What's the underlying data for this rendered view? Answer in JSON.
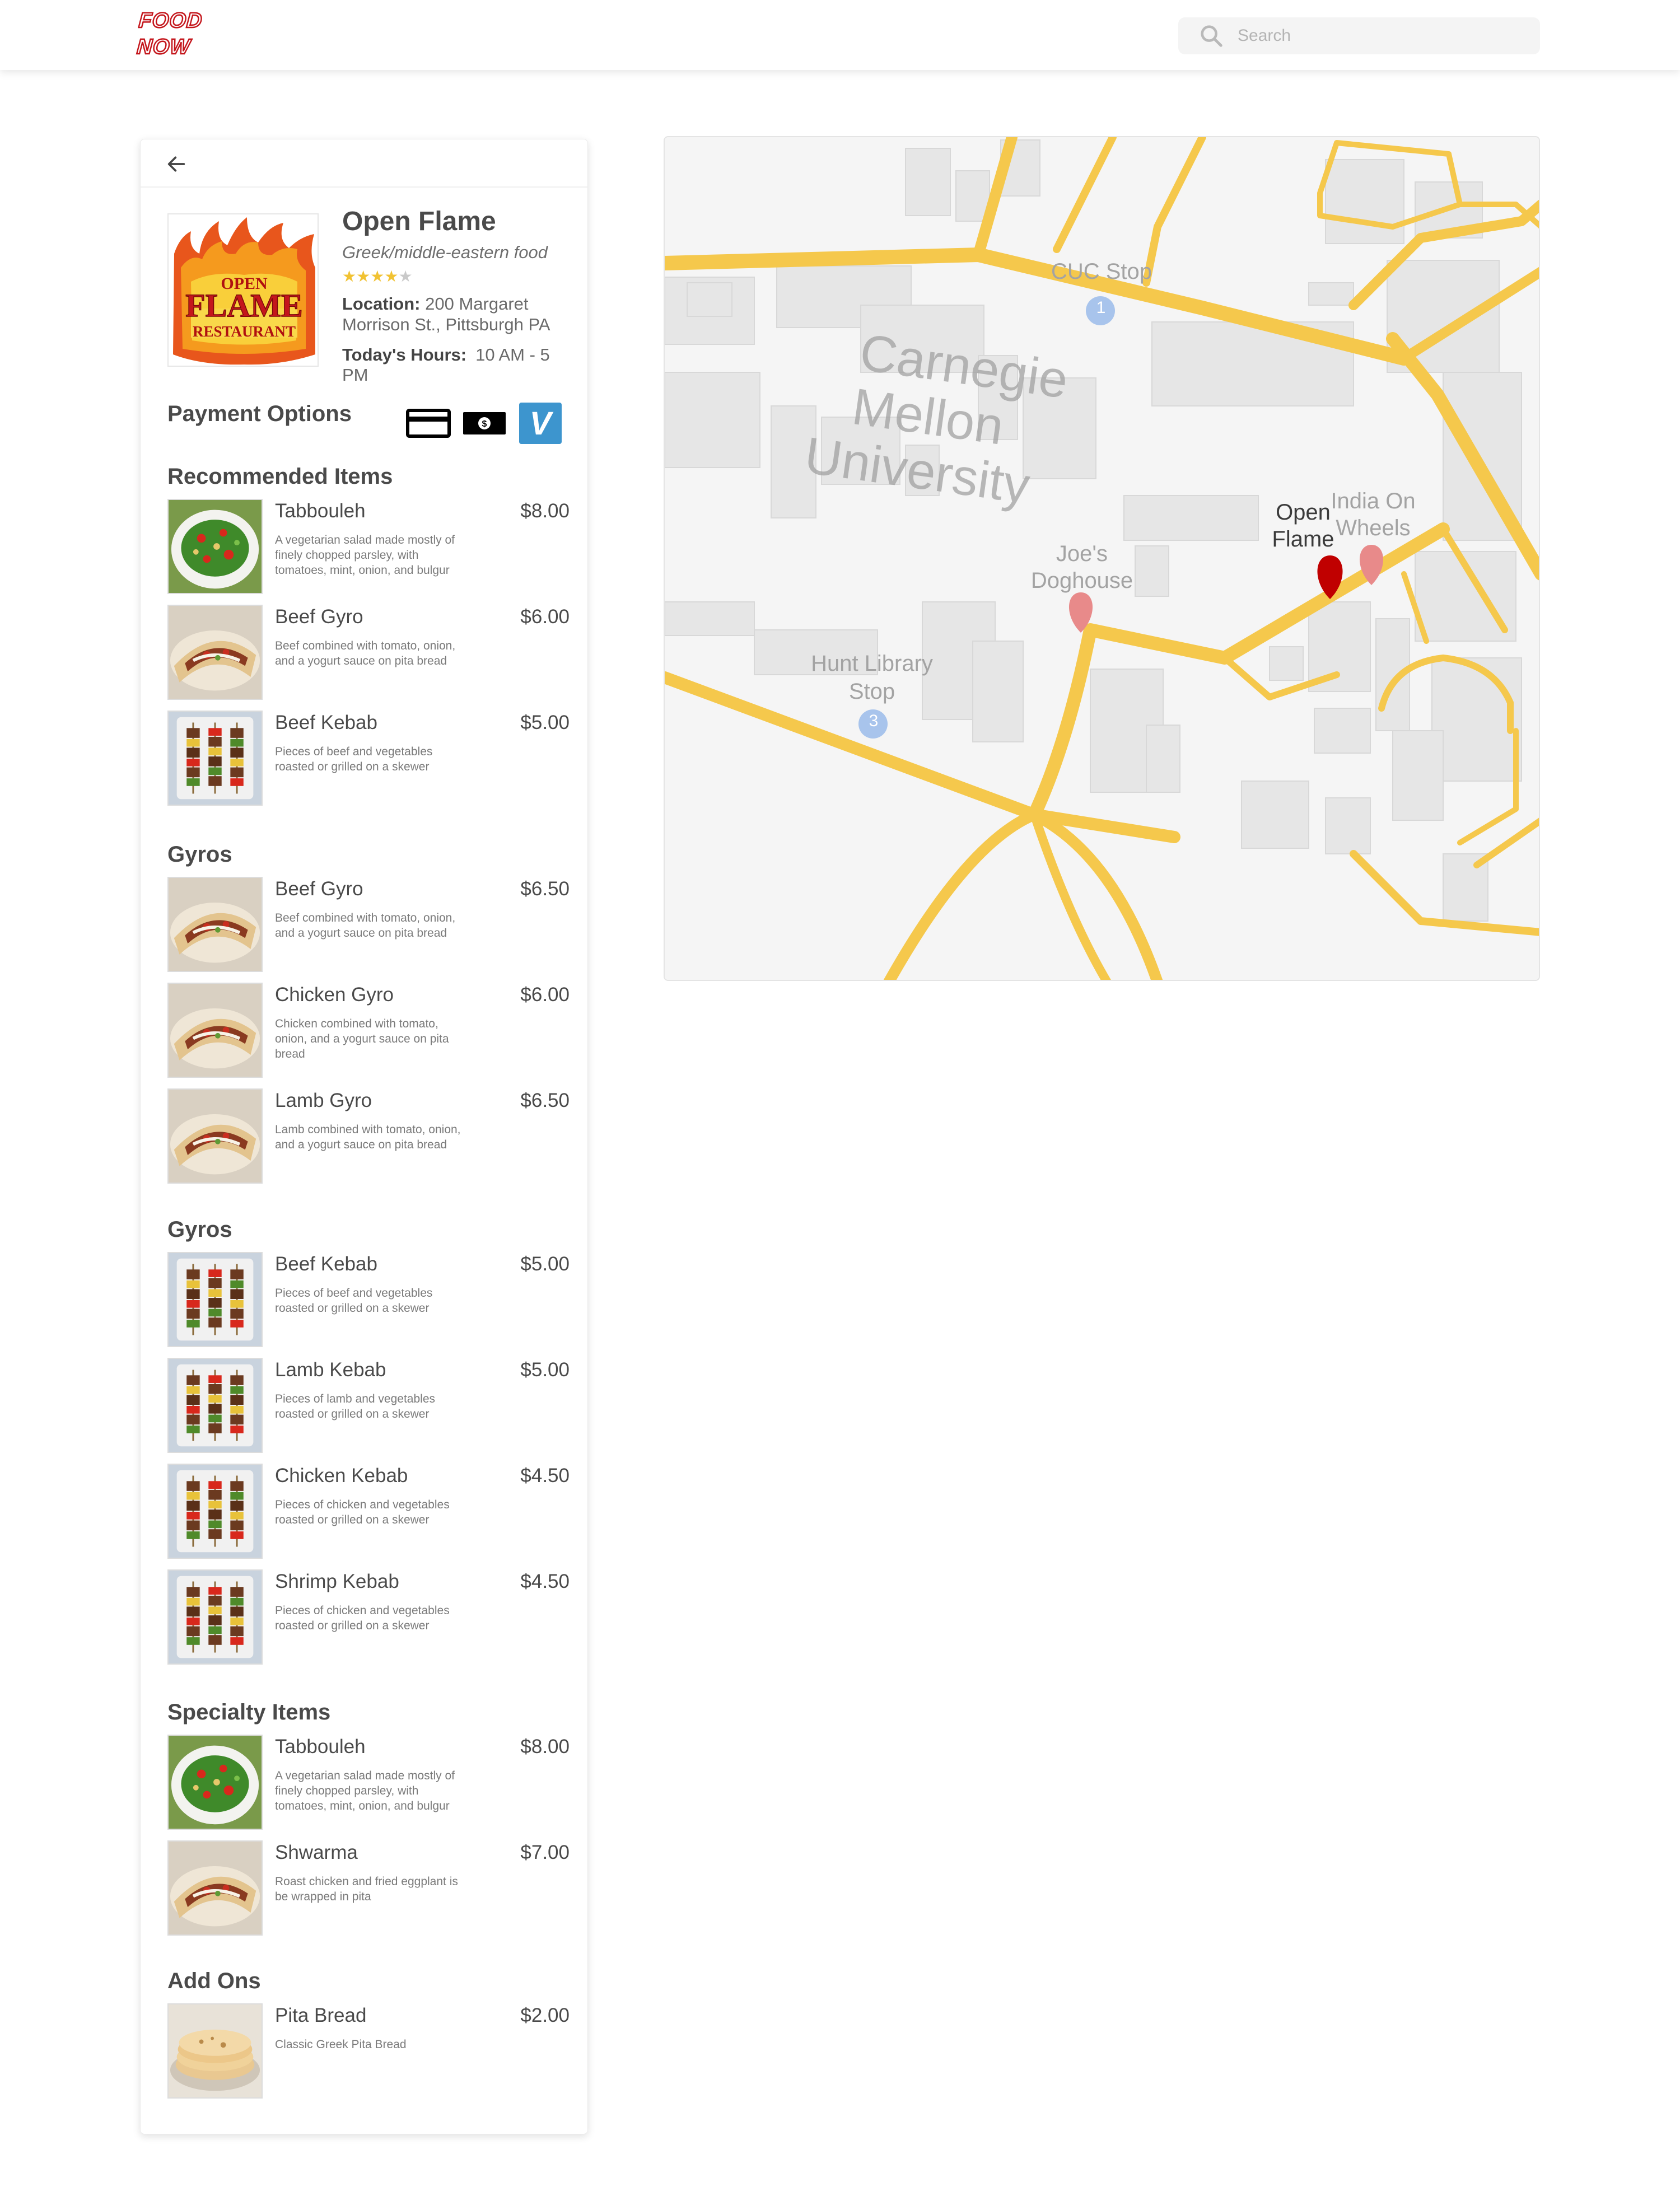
{
  "app": {
    "logo_line1": "FOOD",
    "logo_line2": "NOW",
    "search_placeholder": "Search",
    "brand_color": "#c4161c"
  },
  "restaurant": {
    "name": "Open Flame",
    "cuisine": "Greek/middle-eastern food",
    "rating": 4,
    "rating_max": 5,
    "location_label": "Location:",
    "location_line1": "200 Margaret",
    "location_line2": "Morrison St., Pittsburgh PA",
    "hours_label": "Today's Hours:",
    "hours": "10 AM - 5 PM",
    "logo_text_line1": "OPEN",
    "logo_text_line2": "FLAME",
    "logo_text_line3": "RESTAURANT"
  },
  "payment": {
    "label": "Payment Options",
    "methods": [
      "credit-card-icon",
      "cash-icon",
      "venmo-icon"
    ],
    "venmo_letter": "V"
  },
  "sections": [
    {
      "title": "Recommended Items",
      "items": [
        {
          "name": "Tabbouleh",
          "price": "$8.00",
          "desc": "A vegetarian salad made mostly of finely chopped parsley, with tomatoes, mint, onion, and bulgur",
          "photo": "salad"
        },
        {
          "name": "Beef Gyro",
          "price": "$6.00",
          "desc": "Beef combined with tomato, onion, and a yogurt sauce on pita bread",
          "photo": "gyro"
        },
        {
          "name": "Beef Kebab",
          "price": "$5.00",
          "desc": "Pieces of beef and vegetables roasted or grilled on a skewer",
          "photo": "kebab"
        }
      ]
    },
    {
      "title": "Gyros",
      "items": [
        {
          "name": "Beef Gyro",
          "price": "$6.50",
          "desc": "Beef combined with tomato, onion, and a yogurt sauce on pita bread",
          "photo": "gyro"
        },
        {
          "name": "Chicken Gyro",
          "price": "$6.00",
          "desc": "Chicken combined with tomato, onion, and a yogurt sauce on pita bread",
          "photo": "gyro"
        },
        {
          "name": "Lamb Gyro",
          "price": "$6.50",
          "desc": "Lamb combined with tomato, onion, and a yogurt sauce on pita bread",
          "photo": "gyro"
        }
      ]
    },
    {
      "title": "Gyros",
      "items": [
        {
          "name": "Beef Kebab",
          "price": "$5.00",
          "desc": "Pieces of beef and vegetables roasted or grilled on a skewer",
          "photo": "kebab"
        },
        {
          "name": "Lamb Kebab",
          "price": "$5.00",
          "desc": "Pieces of lamb and vegetables roasted or grilled on a skewer",
          "photo": "kebab"
        },
        {
          "name": "Chicken Kebab",
          "price": "$4.50",
          "desc": "Pieces of chicken and vegetables roasted or grilled on a skewer",
          "photo": "kebab"
        },
        {
          "name": "Shrimp Kebab",
          "price": "$4.50",
          "desc": "Pieces of chicken and vegetables roasted or grilled on a skewer",
          "photo": "kebab"
        }
      ]
    },
    {
      "title": "Specialty Items",
      "items": [
        {
          "name": "Tabbouleh",
          "price": "$8.00",
          "desc": "A vegetarian salad made mostly of finely chopped parsley, with tomatoes, mint, onion, and bulgur",
          "photo": "salad"
        },
        {
          "name": "Shwarma",
          "price": "$7.00",
          "desc": "Roast chicken and fried eggplant is be wrapped in pita",
          "photo": "gyro"
        }
      ]
    },
    {
      "title": "Add Ons",
      "items": [
        {
          "name": "Pita Bread",
          "price": "$2.00",
          "desc": "Classic Greek Pita Bread",
          "photo": "pita"
        }
      ]
    }
  ],
  "map": {
    "campus_line1": "Carnegie",
    "campus_line2": "Mellon",
    "campus_line3": "University",
    "stops": [
      {
        "name_line1": "CUC Stop",
        "name_line2": "",
        "number": "1"
      },
      {
        "name_line1": "Hunt Library",
        "name_line2": "Stop",
        "number": "3"
      }
    ],
    "places": [
      {
        "name_line1": "Open",
        "name_line2": "Flame",
        "selected": true
      },
      {
        "name_line1": "India On",
        "name_line2": "Wheels",
        "selected": false
      },
      {
        "name_line1": "Joe's",
        "name_line2": "Doghouse",
        "selected": false
      }
    ],
    "road_color": "#f5c84c",
    "selected_pin_color": "#c00000",
    "other_pin_color": "#e88a8a",
    "stop_color": "#a8c4ec"
  }
}
